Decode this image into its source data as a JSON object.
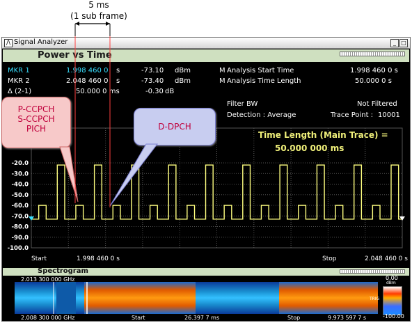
{
  "annotation_top": {
    "line1": "5 ms",
    "line2": "(1 sub frame)"
  },
  "window": {
    "title": "Signal Analyzer",
    "app_glyph": "/\\",
    "min_glyph": "_",
    "max_glyph": "□",
    "close_glyph": "×"
  },
  "panel": {
    "title": "Power vs Time"
  },
  "markers": {
    "mkr1": {
      "label": "MKR 1",
      "time": "1.998 460 0",
      "unit": "s",
      "level": "-73.10",
      "level_unit": "dBm"
    },
    "mkr2": {
      "label": "MKR 2",
      "time": "2.048 460 0",
      "unit": "s",
      "level": "-73.40",
      "level_unit": "dBm"
    },
    "delta": {
      "label": "Δ (2-1)",
      "time": "50.000 0 ms",
      "level": "-0.30",
      "level_unit": "dB"
    }
  },
  "analysis": {
    "start_label": "Analysis Start Time",
    "start_value": "1.998 460 0 s",
    "length_label": "Analysis Time Length",
    "length_value": "50.000 0 s",
    "filter_label": "Filter BW",
    "filter_value": "Not Filtered",
    "detection": "Detection : Average",
    "trace_point_label": "Trace Point :",
    "trace_point_value": "10001",
    "m_glyph": "M"
  },
  "time_length": {
    "line1": "Time Length (Main Trace) =",
    "line2": "50.000 000 ms"
  },
  "callouts": {
    "left": [
      "P-CCPCH",
      "S-CCPCH",
      "PICH"
    ],
    "right": "D-DPCH"
  },
  "chart_data": {
    "type": "line",
    "title": "Power vs Time",
    "xlabel": "",
    "ylabel": "",
    "y_ticks": [
      "-20.0",
      "-30.0",
      "-40.0",
      "-50.0",
      "-60.0",
      "-70.0",
      "-80.0",
      "-90.0",
      "-100.0"
    ],
    "ylim": [
      -100,
      -20
    ],
    "xlim": [
      0,
      50
    ],
    "x_start_label": "Start",
    "x_start": "1.998 460 0 s",
    "x_stop_label": "Stop",
    "x_stop": "2.048 460 0 s",
    "series": [
      {
        "color": "#ffff80",
        "x": [
          0,
          0.5,
          1,
          1.5,
          2,
          2.5,
          3,
          3.5,
          4,
          4.5,
          5,
          5.5,
          6,
          6.5,
          7,
          7.5,
          8,
          8.5,
          9,
          9.5,
          10,
          10.5,
          11,
          11.5,
          12,
          12.5,
          13,
          13.5,
          14,
          14.5,
          15,
          15.5,
          16,
          16.5,
          17,
          17.5,
          18,
          18.5,
          19,
          19.5,
          20,
          20.5,
          21,
          21.5,
          22,
          22.5,
          23,
          23.5,
          24,
          24.5,
          25,
          25.5,
          26,
          26.5,
          27,
          27.5,
          28,
          28.5,
          29,
          29.5,
          30,
          30.5,
          31,
          31.5,
          32,
          32.5,
          33,
          33.5,
          34,
          34.5,
          35,
          35.5,
          36,
          36.5,
          37,
          37.5,
          38,
          38.5,
          39,
          39.5,
          40,
          40.5,
          41,
          41.5,
          42,
          42.5,
          43,
          43.5,
          44,
          44.5,
          45,
          45.5,
          46,
          46.5,
          47,
          47.5,
          48,
          48.5,
          49,
          49.5,
          50
        ],
        "y": [
          -73,
          -73,
          -60,
          -60,
          -73,
          -73,
          -73,
          -22,
          -22,
          -73,
          -73,
          -73,
          -60,
          -60,
          -73,
          -73,
          -73,
          -22,
          -22,
          -73,
          -73,
          -73,
          -60,
          -60,
          -73,
          -73,
          -73,
          -22,
          -22,
          -73,
          -73,
          -73,
          -60,
          -60,
          -73,
          -73,
          -73,
          -22,
          -22,
          -73,
          -73,
          -73,
          -60,
          -60,
          -73,
          -73,
          -73,
          -22,
          -22,
          -73,
          -73,
          -73,
          -60,
          -60,
          -73,
          -73,
          -73,
          -22,
          -22,
          -73,
          -73,
          -73,
          -60,
          -60,
          -73,
          -73,
          -73,
          -22,
          -22,
          -73,
          -73,
          -73,
          -60,
          -60,
          -73,
          -73,
          -73,
          -22,
          -22,
          -73,
          -73,
          -73,
          -60,
          -60,
          -73,
          -73,
          -73,
          -22,
          -22,
          -73,
          -73,
          -73,
          -60,
          -60,
          -73,
          -73,
          -73,
          -22,
          -22,
          -73,
          -73
        ]
      }
    ],
    "markers_x": [
      0,
      50
    ]
  },
  "spectrogram": {
    "title": "Spectrogram",
    "freq_top": "2.013 300 000 GHz",
    "freq_bottom": "2.008 300 000 GHz",
    "start_label": "Start",
    "start_value": "26.397 7 ms",
    "stop_label": "Stop",
    "stop_value": "9.973 597 7 s",
    "scale_top": "0.00",
    "scale_unit_top": "dBm",
    "scale_bottom": "-100.00",
    "scale_unit_bottom": "dBm",
    "trig_label": "TRIG"
  }
}
